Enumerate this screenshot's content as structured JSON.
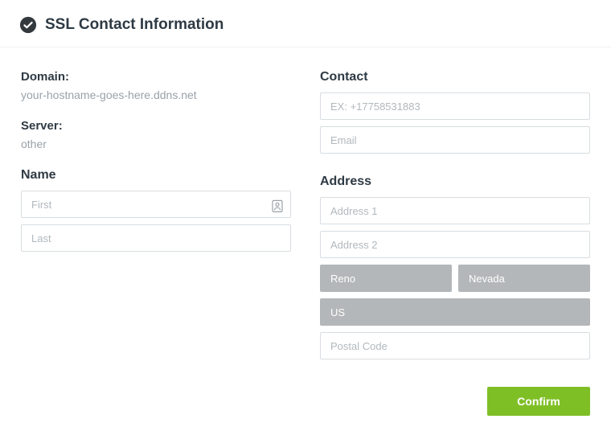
{
  "header": {
    "title": "SSL Contact Information"
  },
  "left": {
    "domain_label": "Domain:",
    "domain_value": "your-hostname-goes-here.ddns.net",
    "server_label": "Server:",
    "server_value": "other",
    "name_heading": "Name",
    "first_placeholder": "First",
    "last_placeholder": "Last"
  },
  "right": {
    "contact_heading": "Contact",
    "phone_placeholder": "EX: +17758531883",
    "email_placeholder": "Email",
    "address_heading": "Address",
    "addr1_placeholder": "Address 1",
    "addr2_placeholder": "Address 2",
    "city_value": "Reno",
    "state_value": "Nevada",
    "country_value": "US",
    "postal_placeholder": "Postal Code"
  },
  "footer": {
    "confirm_label": "Confirm"
  }
}
